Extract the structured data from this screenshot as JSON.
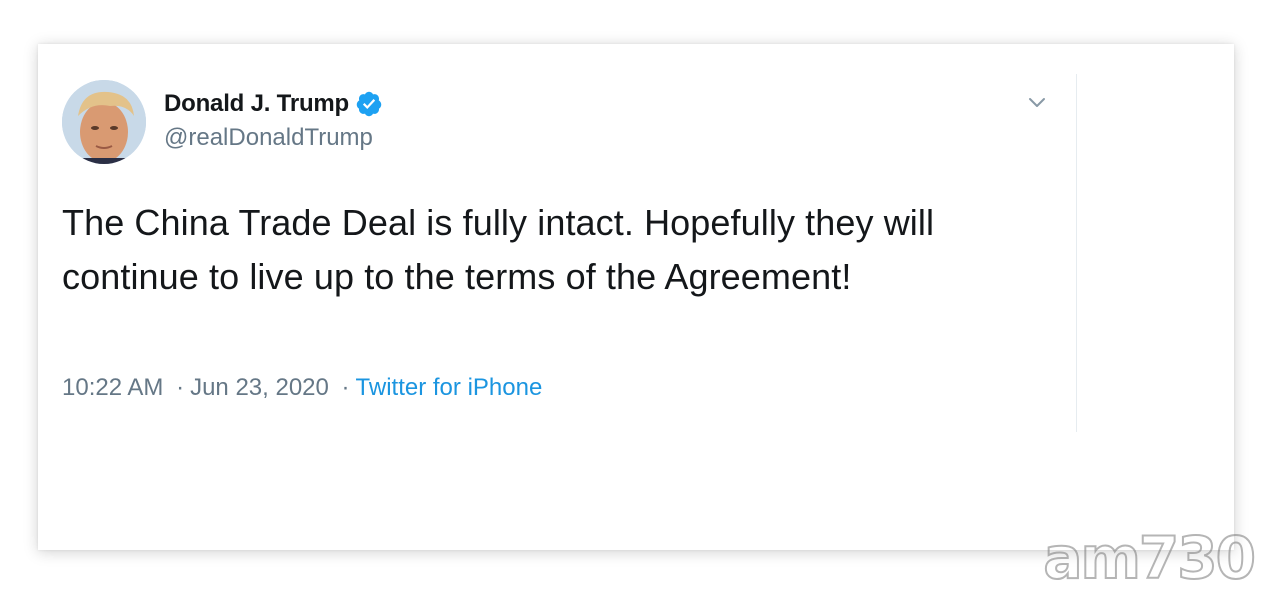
{
  "tweet": {
    "author_name": "Donald J. Trump",
    "author_handle": "@realDonaldTrump",
    "text": "The China Trade Deal is fully intact. Hopefully they will continue to live up to the terms of the Agreement!",
    "time": "10:22 AM",
    "separator": "·",
    "date": "Jun 23, 2020",
    "source": "Twitter for iPhone",
    "verified_icon": "verified-badge-icon",
    "menu_icon": "chevron-down-icon"
  },
  "watermark": {
    "text": "am730"
  },
  "colors": {
    "text_primary": "#14171a",
    "text_secondary": "#657786",
    "link": "#1b95e0",
    "verified": "#1da1f2"
  }
}
